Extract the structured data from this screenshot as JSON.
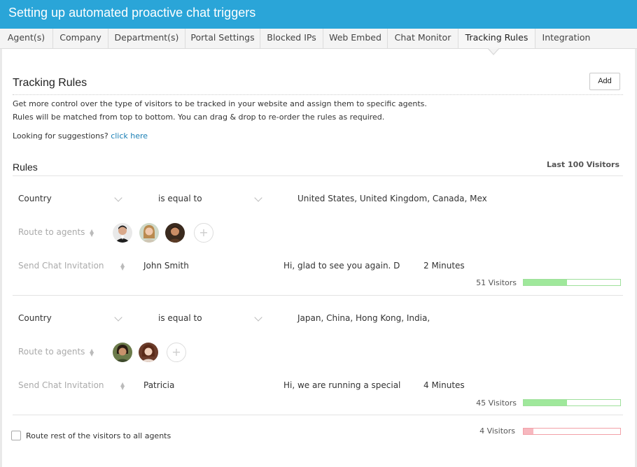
{
  "window": {
    "title": "Setting up automated proactive chat triggers"
  },
  "tabs": [
    {
      "label": "Agent(s)"
    },
    {
      "label": "Company"
    },
    {
      "label": "Department(s)"
    },
    {
      "label": "Portal Settings"
    },
    {
      "label": "Blocked IPs"
    },
    {
      "label": "Web Embed"
    },
    {
      "label": "Chat Monitor"
    },
    {
      "label": "Tracking Rules",
      "active": true
    },
    {
      "label": "Integration"
    }
  ],
  "page": {
    "heading": "Tracking Rules",
    "add_label": "Add",
    "description_line1": "Get more control over the type of visitors to be tracked in your website and assign them to specific agents.",
    "description_line2": "Rules will be matched from top to bottom. You can drag & drop to re-order the rules as required.",
    "suggestions_prefix": "Looking for suggestions?",
    "suggestions_link": "click here",
    "rules_label": "Rules",
    "last_visitors_label": "Last 100 Visitors"
  },
  "rules": [
    {
      "condition_field": "Country",
      "condition_operator": "is equal to",
      "condition_value": "United States, United Kingdom, Canada, Mex",
      "route_label": "Route to agents",
      "agents": [
        "agent-1",
        "agent-2",
        "agent-3"
      ],
      "invite_label": "Send Chat Invitation",
      "invite_agent": "John Smith",
      "invite_message": "Hi, glad to see you again. Do",
      "invite_delay": "2 Minutes",
      "visitors_label": "51 Visitors",
      "visitors_share": 0.45
    },
    {
      "condition_field": "Country",
      "condition_operator": "is equal to",
      "condition_value": "Japan, China, Hong Kong, India,",
      "route_label": "Route to agents",
      "agents": [
        "agent-4",
        "agent-5"
      ],
      "invite_label": "Send Chat Invitation",
      "invite_agent": "Patricia",
      "invite_message": "Hi, we are running a special",
      "invite_delay": "4 Minutes",
      "visitors_label": "45 Visitors",
      "visitors_share": 0.45
    }
  ],
  "footer": {
    "route_rest_label": "Route rest of the visitors to all agents",
    "rest_visitors_label": "4 Visitors",
    "rest_visitors_share": 0.1
  },
  "colors": {
    "header_blue": "#2aa5d8",
    "link_blue": "#1a7fb5",
    "bar_green": "#9fe89b",
    "bar_red": "#f7b8bf"
  }
}
